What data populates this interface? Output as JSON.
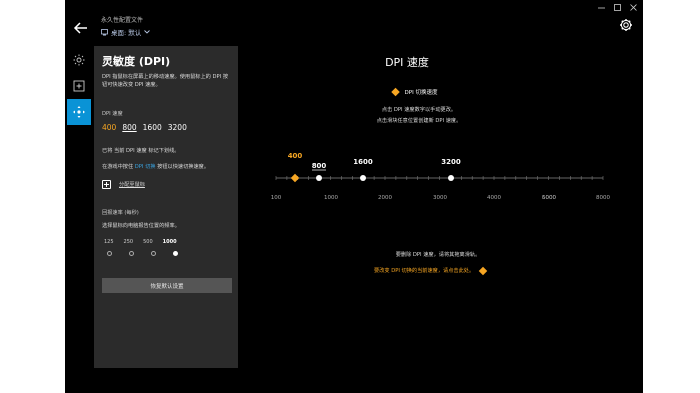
{
  "window": {
    "profile_heading": "永久性配置文件",
    "profile_name": "桌面: 默认"
  },
  "rail": {
    "items": [
      {
        "name": "rail-lighting",
        "icon": "sun-icon"
      },
      {
        "name": "rail-assignments",
        "icon": "plus-square-icon"
      },
      {
        "name": "rail-sensitivity",
        "icon": "move-icon",
        "active": true
      }
    ]
  },
  "panel": {
    "title": "灵敏度 (DPI)",
    "desc_a": "DPI 指鼠标在屏幕上的移动速度。使用鼠标上的 DPI 按钮可快速改变 DPI 速度。",
    "dpi_label": "DPI 速度",
    "dpi_values": [
      "400",
      "800",
      "1600",
      "3200"
    ],
    "dpi_shift_value": "400",
    "dpi_default_value": "800",
    "note_default": "已将 当前 DPI 速度 标记下划线。",
    "note_shift_prefix": "在游戏中按住",
    "note_shift_hl": "DPI 切换",
    "note_shift_suffix": "按钮以快速切换速度。",
    "add_level_label": "分配至鼠标",
    "rate_label": "回报速率 (每秒)",
    "rate_desc": "选择鼠标向电脑报告位置的频率。",
    "rate_values": [
      "125",
      "250",
      "500",
      "1000"
    ],
    "rate_selected": "1000",
    "reset_label": "恢复默认设置"
  },
  "main": {
    "title": "DPI 速度",
    "legend_shift": "DPI 切换速度",
    "hint_1": "点击 DPI 速度数字以手动更改。",
    "hint_2": "点击滑块任意位置创建新 DPI 速度。",
    "hint_3": "要删除 DPI 速度，请将其拖离滑轨。",
    "hint_4": "要改变 DPI 切换的当前速度，请点击此处。"
  },
  "colors": {
    "accent_blue": "#0a93d6",
    "shift_orange": "#f6a623",
    "panel_bg": "#2b2b2b"
  },
  "chart_data": {
    "type": "scatter",
    "scale_ticks": [
      "100",
      "1000",
      "2000",
      "3000",
      "4000",
      "5000",
      "6000",
      "8000"
    ],
    "markers": [
      {
        "label": "400",
        "value": 400,
        "kind": "shift"
      },
      {
        "label": "800",
        "value": 800,
        "kind": "default"
      },
      {
        "label": "1600",
        "value": 1600,
        "kind": "normal"
      },
      {
        "label": "3200",
        "value": 3200,
        "kind": "normal"
      }
    ]
  }
}
